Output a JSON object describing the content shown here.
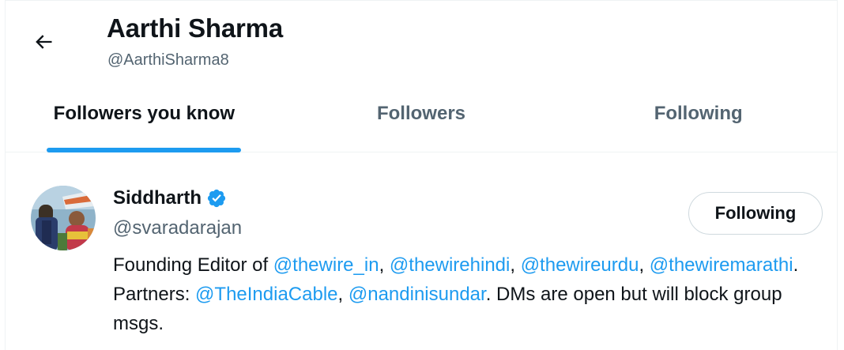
{
  "header": {
    "back_icon": "arrow-left-icon",
    "name": "Aarthi Sharma",
    "handle": "@AarthiSharma8"
  },
  "tabs": [
    {
      "label": "Followers you know",
      "active": true
    },
    {
      "label": "Followers",
      "active": false
    },
    {
      "label": "Following",
      "active": false
    }
  ],
  "colors": {
    "accent": "#1d9bf0",
    "text_primary": "#0f1419",
    "text_secondary": "#536471",
    "border": "#eff3f4"
  },
  "user": {
    "name": "Siddharth",
    "verified_icon": "verified-badge-icon",
    "handle": "@svaradarajan",
    "follow_button_label": "Following",
    "bio": {
      "t1": "Founding Editor of ",
      "m1": "@thewire_in",
      "t2": ", ",
      "m2": "@thewirehindi",
      "t3": ", ",
      "m3": "@thewireurdu",
      "t4": ", ",
      "m4": "@thewiremarathi",
      "t5": ". Partners: ",
      "m5": "@TheIndiaCable",
      "t6": ", ",
      "m6": "@nandinisundar",
      "t7": ". DMs are open but will block group msgs."
    }
  }
}
